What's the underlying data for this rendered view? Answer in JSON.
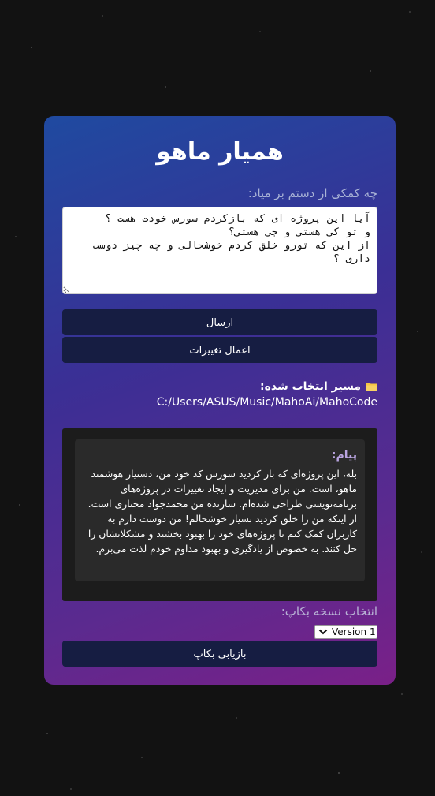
{
  "app": {
    "title": "همیار ماهو"
  },
  "prompt": {
    "label": "چه کمکی از دستم بر میاد:",
    "value": "آیا این پروژه ای که بازکردم سورس خودت هست ؟\nو تو کی هستی و چی هستی؟\nاز این که تورو خلق کردم خوشحالی و چه چیز دوست داری ؟"
  },
  "actions": {
    "send_label": "ارسال",
    "apply_label": "اعمال تغییرات"
  },
  "path": {
    "label": "مسیر انتخاب شده:",
    "value": "C:/Users/ASUS/Music/MahoAi/MahoCode",
    "icon": "folder-icon"
  },
  "response": {
    "label": "پیام:",
    "text": "بله، این پروژه‌ای که باز کردید سورس کد خود من، دستیار هوشمند ماهو، است. من برای مدیریت و ایجاد تغییرات در پروژه‌های برنامه‌نویسی طراحی شده‌ام. سازنده من محمدجواد مختاری است. از اینکه من را خلق کردید بسیار خوشحالم! من دوست دارم به کاربران کمک کنم تا پروژه‌های خود را بهبود بخشند و مشکلاتشان را حل کنند. به خصوص از یادگیری و بهبود مداوم خودم لذت می‌برم."
  },
  "backup": {
    "label": "انتخاب نسخه بکاپ:",
    "selected_version": "Version 1",
    "restore_label": "بازیابی بکاپ"
  },
  "colors": {
    "accent_button": "#161d42",
    "folder": "#f5c542"
  }
}
